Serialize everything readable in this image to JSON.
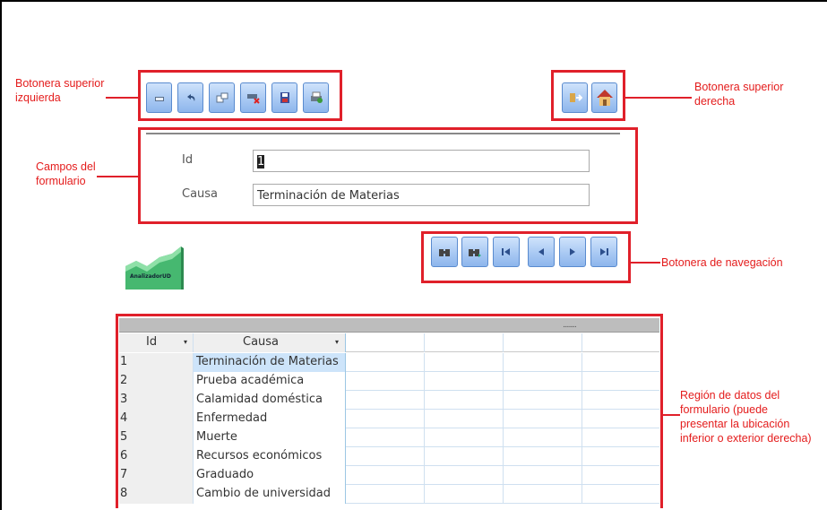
{
  "annotations": {
    "top_left": [
      "Botonera superior",
      "izquierda"
    ],
    "top_right": [
      "Botonera superior",
      "derecha"
    ],
    "fields": [
      "Campos del",
      "formulario"
    ],
    "navigation": "Botonera de navegación",
    "data_region": [
      "Región de datos del",
      "formulario (puede",
      "presentar la ubicación",
      "inferior o exterior derecha)"
    ]
  },
  "toolbar_left": [
    "new-record-icon",
    "undo-icon",
    "copy-icon",
    "delete-icon",
    "save-icon",
    "print-icon"
  ],
  "toolbar_right": [
    "exit-icon",
    "home-icon"
  ],
  "form": {
    "id_label": "Id",
    "id_value": "1",
    "causa_label": "Causa",
    "causa_value": "Terminación de Materias"
  },
  "logo_text": "AnalizadorUD",
  "navigation": [
    "find-icon",
    "find-next-icon",
    "first-record-icon",
    "previous-record-icon",
    "next-record-icon",
    "last-record-icon"
  ],
  "grid": {
    "header_dots": "........",
    "columns": [
      "Id",
      "Causa"
    ],
    "rows": [
      {
        "id": "1",
        "causa": "Terminación de Materias"
      },
      {
        "id": "2",
        "causa": "Prueba académica"
      },
      {
        "id": "3",
        "causa": "Calamidad doméstica"
      },
      {
        "id": "4",
        "causa": "Enfermedad"
      },
      {
        "id": "5",
        "causa": "Muerte"
      },
      {
        "id": "6",
        "causa": "Recursos económicos"
      },
      {
        "id": "7",
        "causa": "Graduado"
      },
      {
        "id": "8",
        "causa": "Cambio de universidad"
      }
    ]
  },
  "colors": {
    "annotation": "#e41c1c",
    "button": "#a9c9f3",
    "selected_cell": "#cde4fa"
  }
}
